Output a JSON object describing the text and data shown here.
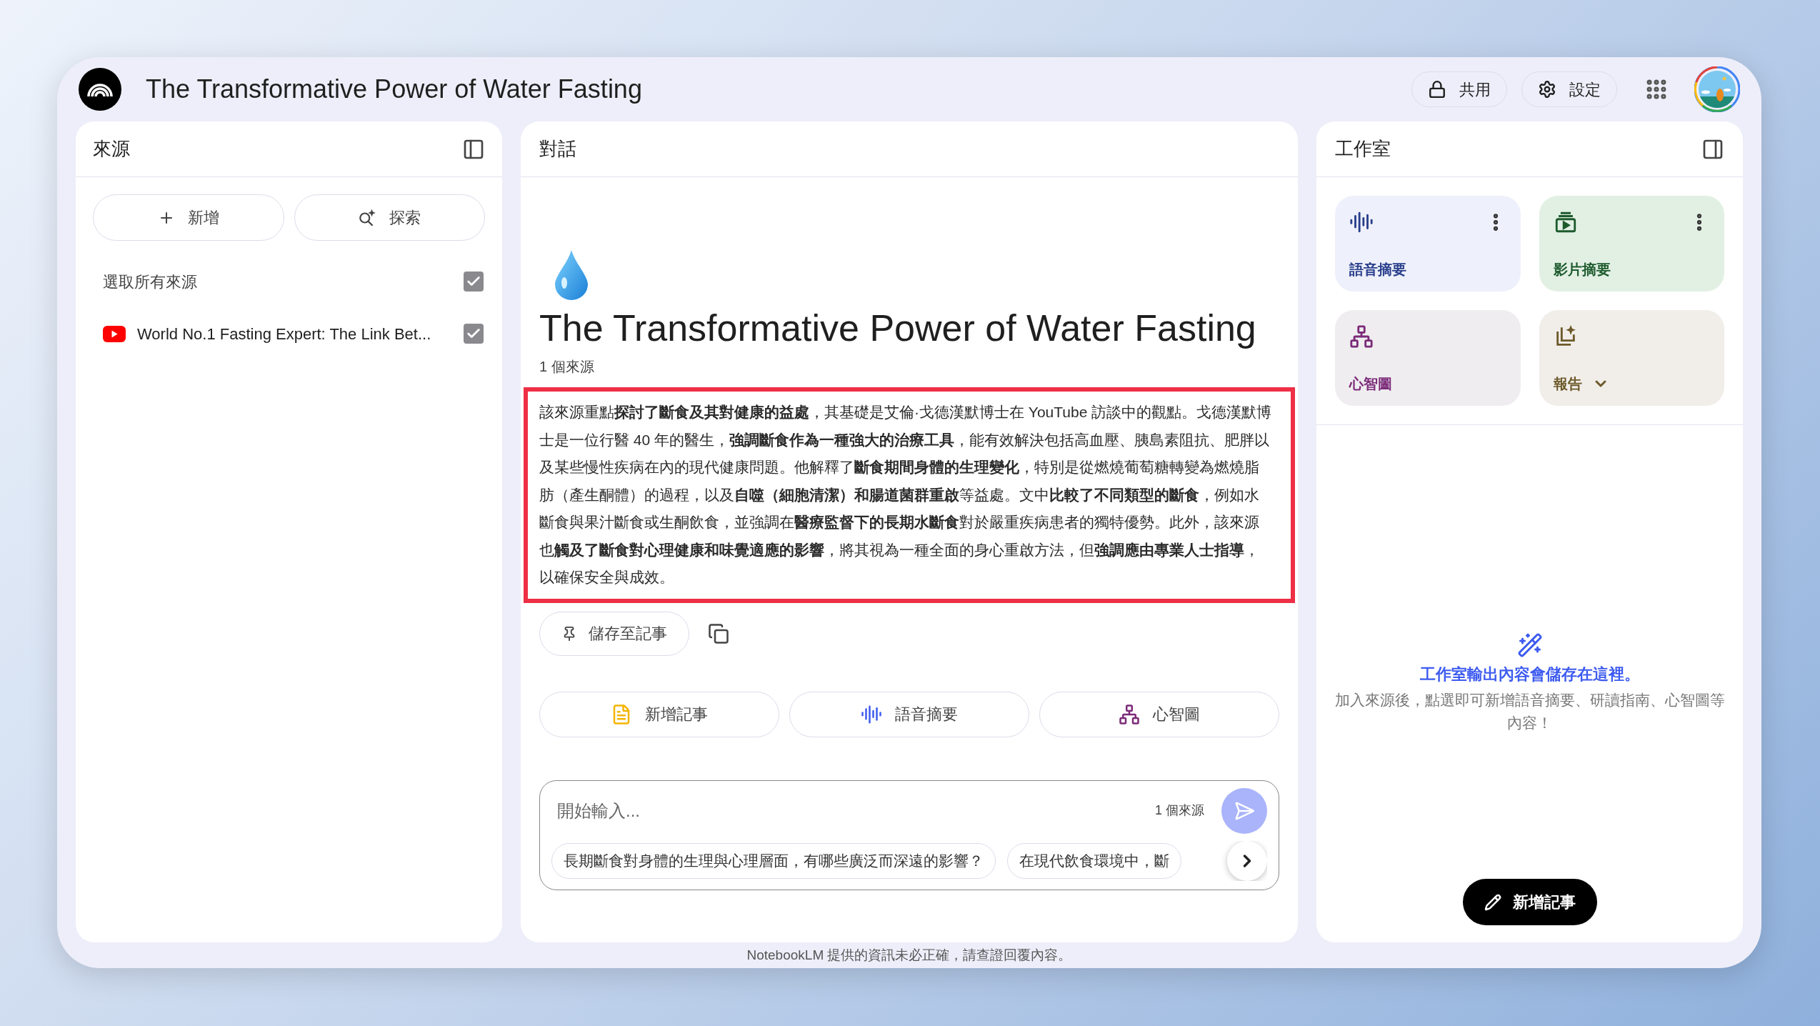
{
  "header": {
    "title": "The Transformative Power of Water Fasting",
    "buttons": [
      {
        "label": "共用",
        "kind": "share"
      },
      {
        "label": "設定",
        "kind": "settings"
      }
    ]
  },
  "sources_panel": {
    "title": "來源",
    "actions": [
      {
        "label": "新增",
        "kind": "add"
      },
      {
        "label": "探索",
        "kind": "discover"
      }
    ],
    "select_all": {
      "label": "選取所有來源",
      "checked": true
    },
    "sources": [
      {
        "title": "World No.1 Fasting Expert: The Link Bet...",
        "kind": "youtube",
        "checked": true
      }
    ]
  },
  "chat_panel": {
    "title": "對話",
    "notebook_title": "The Transformative Power of Water Fasting",
    "source_count": "1 個來源",
    "summary": "該來源重點**探討了斷食及其對健康的益處**，其基礎是艾倫·戈德漢默博士在 YouTube 訪談中的觀點。戈德漢默博士是一位行醫 40 年的醫生，**強調斷食作為一種強大的治療工具**，能有效解決包括高血壓、胰島素阻抗、肥胖以及某些慢性疾病在內的現代健康問題。他解釋了**斷食期間身體的生理變化**，特別是從燃燒葡萄糖轉變為燃燒脂肪（產生酮體）的過程，以及**自噬（細胞清潔）和腸道菌群重啟**等益處。文中**比較了不同類型的斷食**，例如水斷食與果汁斷食或生酮飲食，並強調在**醫療監督下的長期水斷食**對於嚴重疾病患者的獨特優勢。此外，該來源也**觸及了斷食對心理健康和味覺適應的影響**，將其視為一種全面的身心重啟方法，但**強調應由專業人士指導**，以確保安全與成效。",
    "highlighted": true,
    "save_button": "儲存至記事",
    "quick_actions": [
      {
        "label": "新增記事",
        "kind": "note"
      },
      {
        "label": "語音摘要",
        "kind": "audio"
      },
      {
        "label": "心智圖",
        "kind": "mindmap"
      }
    ],
    "input": {
      "placeholder": "開始輸入...",
      "source_count": "1 個來源"
    },
    "suggestions": [
      "長期斷食對身體的生理與心理層面，有哪些廣泛而深遠的影響？",
      "在現代飲食環境中，斷"
    ]
  },
  "studio_panel": {
    "title": "工作室",
    "tools": [
      {
        "label": "語音摘要",
        "kind": "audio",
        "menu": true,
        "dropdown": false
      },
      {
        "label": "影片摘要",
        "kind": "video",
        "menu": true,
        "dropdown": false
      },
      {
        "label": "心智圖",
        "kind": "mindmap",
        "menu": false,
        "dropdown": false
      },
      {
        "label": "報告",
        "kind": "report",
        "menu": false,
        "dropdown": true
      }
    ],
    "empty_title": "工作室輸出內容會儲存在這裡。",
    "empty_text": "加入來源後，點選即可新增語音摘要、研讀指南、心智圖等內容！",
    "add_note_button": "新增記事"
  },
  "footer": "NotebookLM 提供的資訊未必正確，請查證回覆內容。"
}
